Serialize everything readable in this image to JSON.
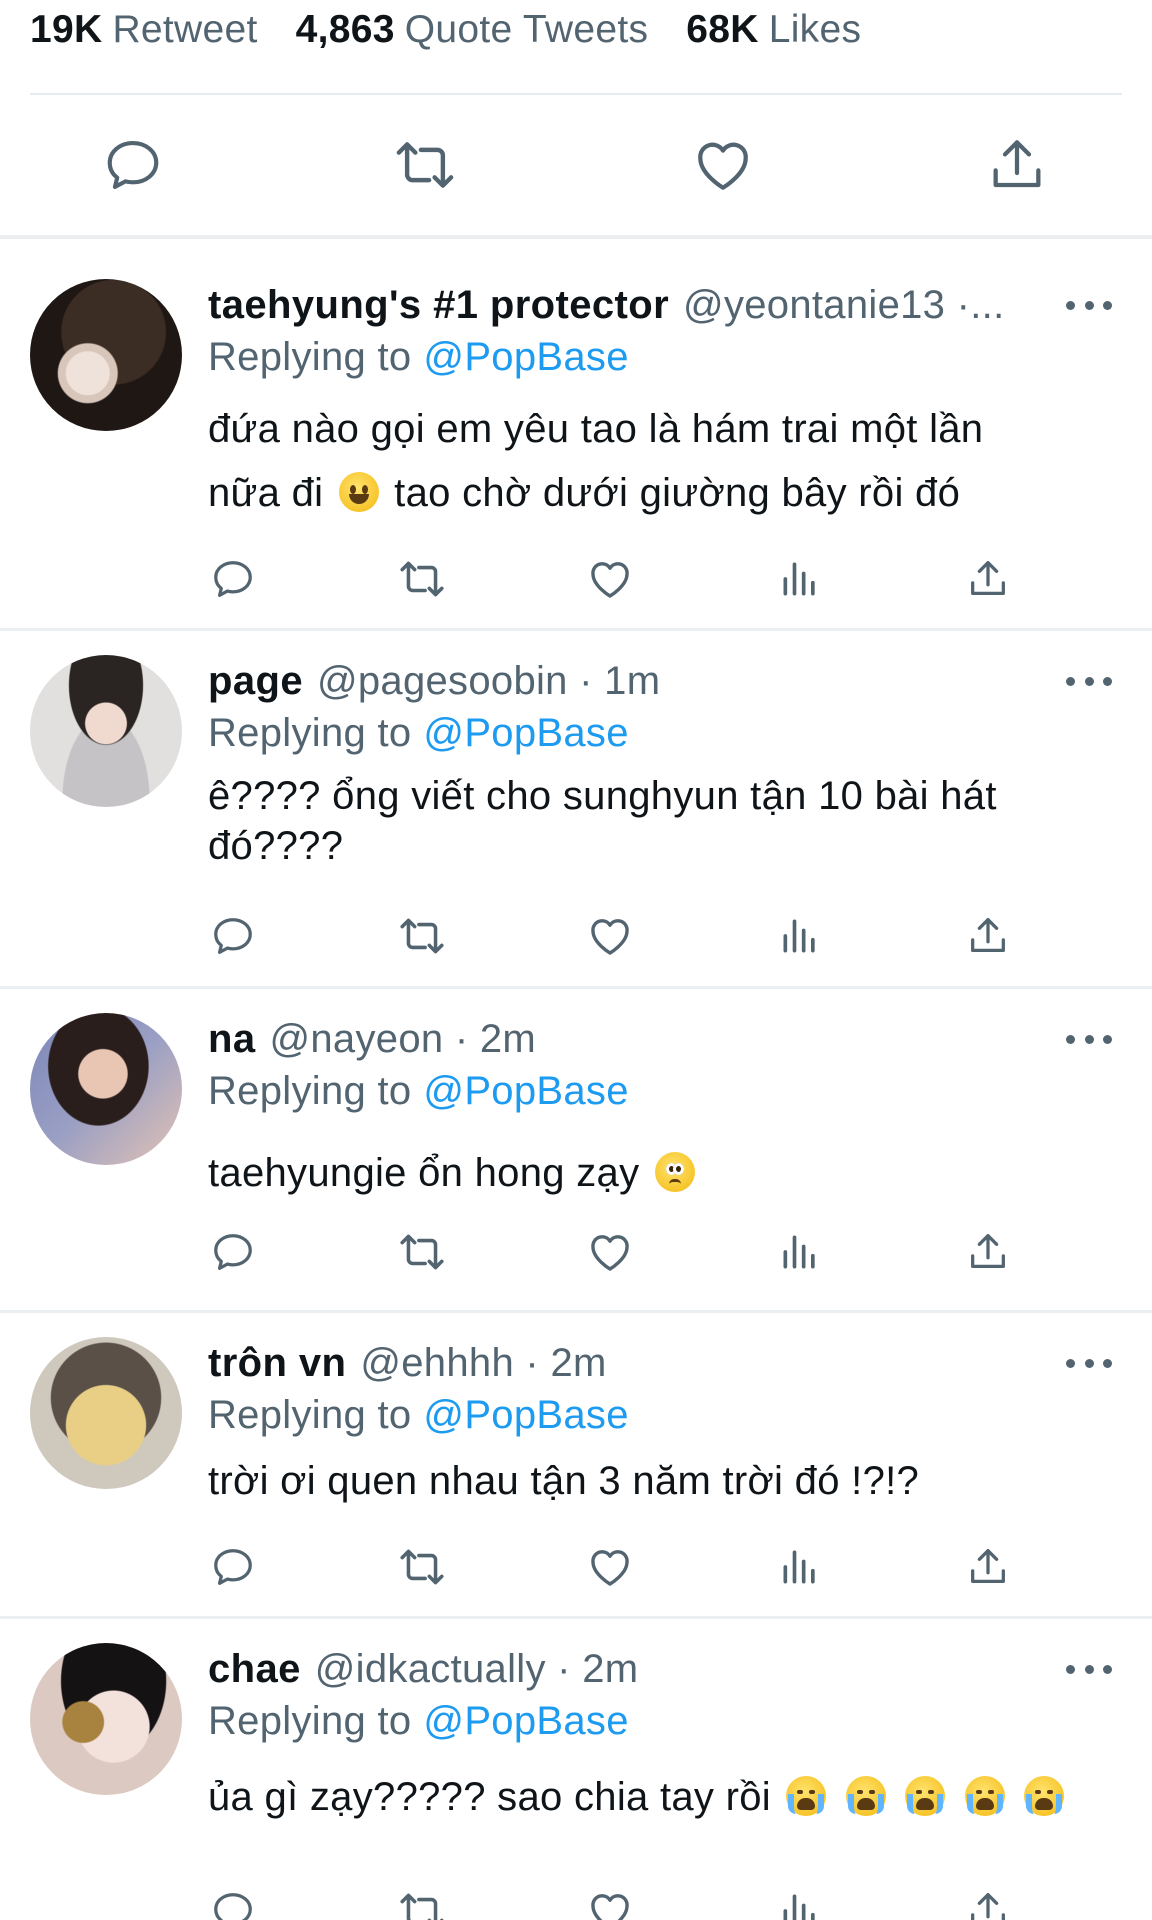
{
  "stats": [
    {
      "count": "19K",
      "label": "Retweet"
    },
    {
      "count": "4,863",
      "label": "Quote Tweets"
    },
    {
      "count": "68K",
      "label": "Likes"
    }
  ],
  "main_actions": [
    "reply-icon",
    "retweet-icon",
    "like-icon",
    "share-icon"
  ],
  "tweets": [
    {
      "name": "taehyung's #1 protector",
      "handle": "@yeontanie13 ·...",
      "replying_label": "Replying to",
      "replying_to": "@PopBase",
      "text_1": "đứa nào gọi em yêu tao là hám trai một lần",
      "text_2a": "nữa đi",
      "text_2b": "tao chờ dưới giường bây rồi đó"
    },
    {
      "name": "page",
      "handle": "@pagesoobin · 1m",
      "replying_label": "Replying to",
      "replying_to": "@PopBase",
      "text_1": "ê???? ổng viết cho sunghyun tận 10 bài hát",
      "text_2": "đó????"
    },
    {
      "name": "na",
      "handle": "@nayeon · 2m",
      "replying_label": "Replying to",
      "replying_to": "@PopBase",
      "text_1": "taehyungie ổn hong zạy"
    },
    {
      "name": "trôn vn",
      "handle": "@ehhhh · 2m",
      "replying_label": "Replying to",
      "replying_to": "@PopBase",
      "text_1": "trời ơi quen nhau tận 3 năm trời đó !?!?"
    },
    {
      "name": "chae",
      "handle": "@idkactually · 2m",
      "replying_label": "Replying to",
      "replying_to": "@PopBase",
      "text_1": "ủa gì zạy????? sao chia tay rồi"
    }
  ],
  "colors": {
    "link": "#1d9bf0",
    "muted": "#536471",
    "text": "#0f1419",
    "divider": "#eceff1"
  }
}
